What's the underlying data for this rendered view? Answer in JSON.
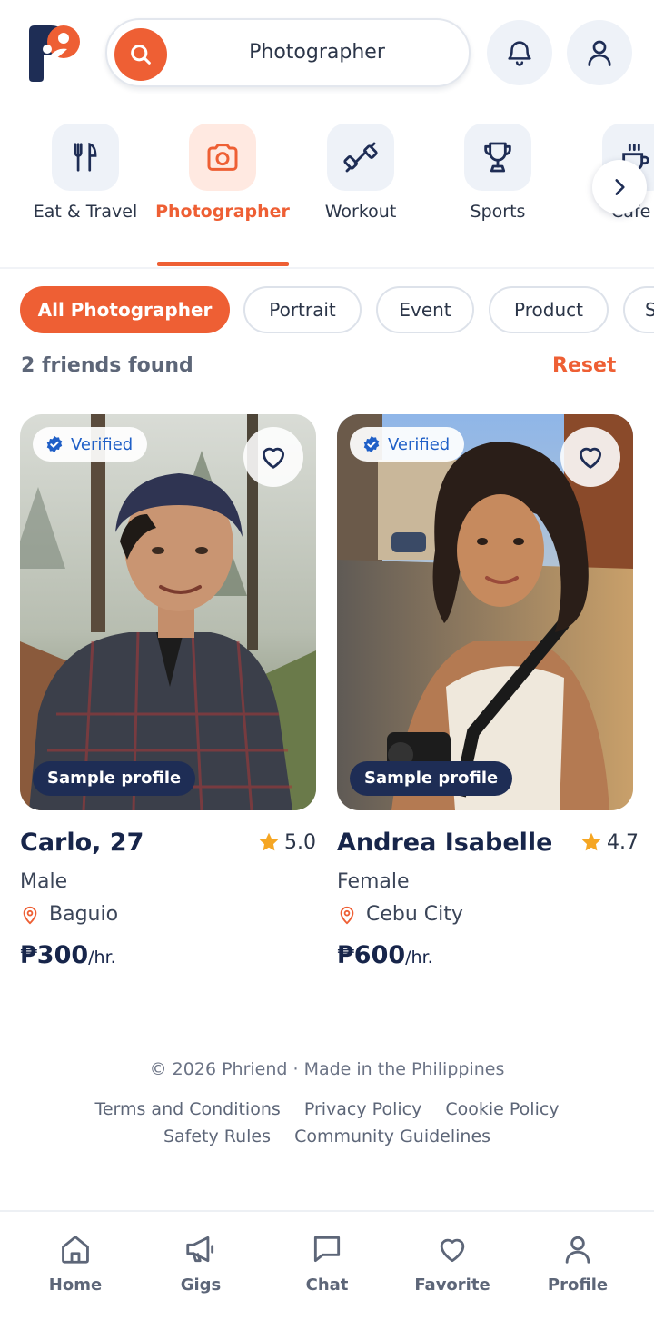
{
  "header": {
    "search_value": "Photographer"
  },
  "categories": [
    {
      "label": "Eat & Travel",
      "icon": "fork-knife-icon"
    },
    {
      "label": "Photographer",
      "icon": "camera-icon",
      "active": true
    },
    {
      "label": "Workout",
      "icon": "dumbbell-icon"
    },
    {
      "label": "Sports",
      "icon": "trophy-icon"
    },
    {
      "label": "Cafe",
      "icon": "coffee-icon"
    }
  ],
  "filters": [
    "All Photographer",
    "Portrait",
    "Event",
    "Product",
    "S"
  ],
  "results": {
    "count_text": "2 friends found",
    "reset_label": "Reset"
  },
  "profiles": [
    {
      "verified": "Verified",
      "sample": "Sample profile",
      "name": "Carlo, 27",
      "rating": "5.0",
      "gender": "Male",
      "city": "Baguio",
      "price": "₱300",
      "unit": "/hr."
    },
    {
      "verified": "Verified",
      "sample": "Sample profile",
      "name": "Andrea Isabelle V",
      "rating": "4.7",
      "gender": "Female",
      "city": "Cebu City",
      "price": "₱600",
      "unit": "/hr."
    }
  ],
  "footer": {
    "copyright": "© 2026 Phriend · Made in the Philippines",
    "links_row1": [
      "Terms and Conditions",
      "Privacy Policy",
      "Cookie Policy"
    ],
    "links_row2": [
      "Safety Rules",
      "Community Guidelines"
    ]
  },
  "nav": [
    {
      "label": "Home",
      "icon": "home-icon"
    },
    {
      "label": "Gigs",
      "icon": "megaphone-icon"
    },
    {
      "label": "Chat",
      "icon": "chat-icon"
    },
    {
      "label": "Favorite",
      "icon": "heart-icon"
    },
    {
      "label": "Profile",
      "icon": "user-icon"
    }
  ],
  "colors": {
    "accent": "#ee5f34",
    "navy": "#1e2d55",
    "verified_blue": "#1f5fc7",
    "star": "#f5a623"
  }
}
